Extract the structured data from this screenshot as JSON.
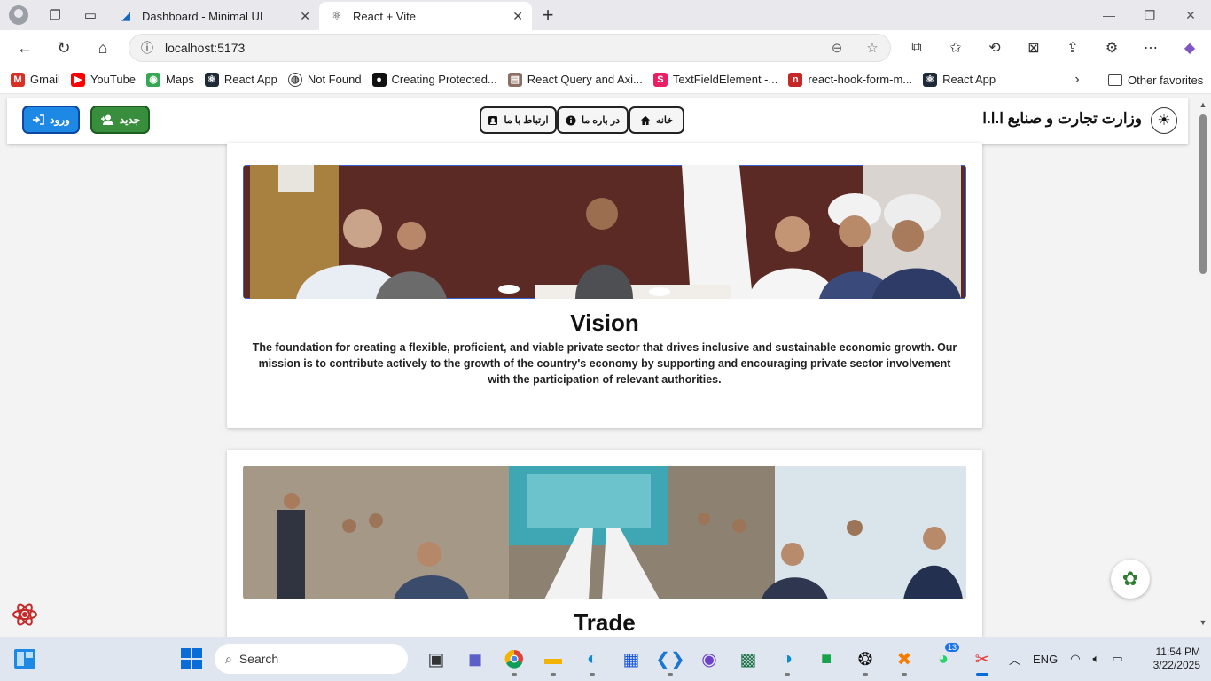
{
  "browser": {
    "tabs": [
      {
        "title": "Dashboard - Minimal UI",
        "active": false
      },
      {
        "title": "React + Vite",
        "active": true
      }
    ],
    "url": "localhost:5173",
    "bookmarks": [
      {
        "label": "Gmail",
        "color": "#d93025",
        "icon": "gmail-icon"
      },
      {
        "label": "YouTube",
        "color": "#ff0000",
        "icon": "youtube-icon"
      },
      {
        "label": "Maps",
        "color": "#34a853",
        "icon": "maps-icon"
      },
      {
        "label": "React App",
        "color": "#1e2a38",
        "icon": "react-icon"
      },
      {
        "label": "Not Found",
        "color": "#555555",
        "icon": "globe-icon"
      },
      {
        "label": "Creating Protected...",
        "color": "#111111",
        "icon": "medium-icon"
      },
      {
        "label": "React Query and Axi...",
        "color": "#8d6e63",
        "icon": "page-icon"
      },
      {
        "label": "TextFieldElement -...",
        "color": "#e91e63",
        "icon": "s-icon"
      },
      {
        "label": "react-hook-form-m...",
        "color": "#c62828",
        "icon": "npm-icon"
      },
      {
        "label": "React App",
        "color": "#1e2a38",
        "icon": "react-icon"
      }
    ],
    "other_favorites": "Other favorites"
  },
  "header": {
    "login_label": "ورود",
    "new_label": "جدید",
    "nav": {
      "contact": "ارتباط با ما",
      "about": "در باره ما",
      "home": "خانه"
    },
    "site_title": "وزارت تجارت و صنایع ا.ا.ا"
  },
  "cards": [
    {
      "heading": "Vision",
      "text": "The foundation for creating a flexible, proficient, and viable private sector that drives inclusive and sustainable economic growth. Our mission is to contribute actively to the growth of the country's economy by supporting and encouraging private sector involvement with the participation of relevant authorities."
    },
    {
      "heading": "Trade",
      "text": ""
    }
  ],
  "taskbar": {
    "search_placeholder": "Search",
    "lang": "ENG",
    "time": "11:54 PM",
    "date": "3/22/2025",
    "whatsapp_badge": "13"
  },
  "colors": {
    "login": "#1e88e5",
    "new": "#388e3c"
  }
}
